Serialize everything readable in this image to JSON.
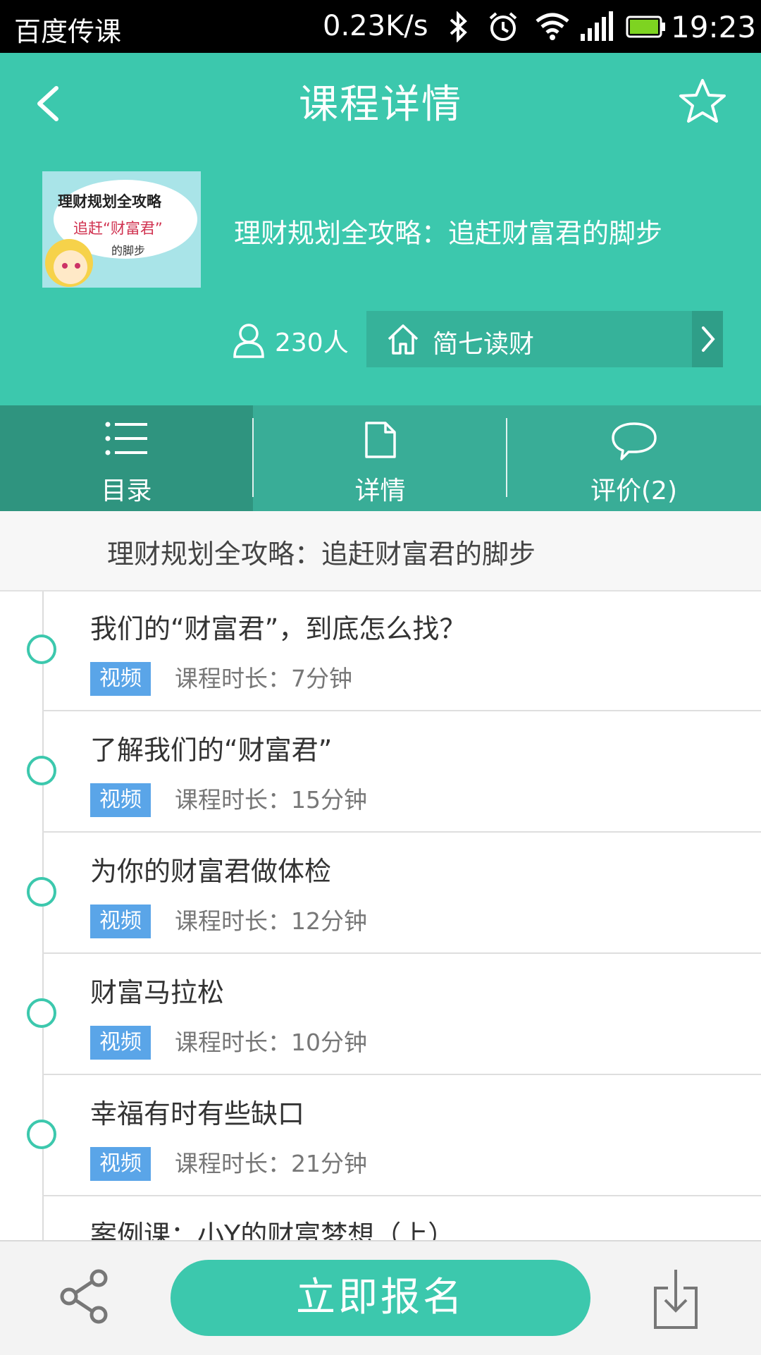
{
  "status_bar": {
    "carrier": "百度传课",
    "net_speed": "0.23K/s",
    "time": "19:23",
    "icons": [
      "bluetooth-icon",
      "alarm-icon",
      "wifi-icon",
      "signal-icon",
      "battery-icon"
    ]
  },
  "header": {
    "title": "课程详情",
    "course_name": "理财规划全攻略：追赶财富君的脚步",
    "learners": "230人",
    "org_name": "简七读财",
    "cover_text": {
      "line1": "理财规划全攻略",
      "line2": "追赶“财富君”",
      "line3": "的脚步"
    }
  },
  "tabs": [
    {
      "label": "目录",
      "icon": "list-icon",
      "active": true
    },
    {
      "label": "详情",
      "icon": "document-icon",
      "active": false
    },
    {
      "label": "评价(2)",
      "icon": "comment-icon",
      "active": false
    }
  ],
  "catalog": {
    "section_title": "理财规划全攻略：追赶财富君的脚步",
    "lessons": [
      {
        "name": "我们的“财富君”，到底怎么找？",
        "tag": "视频",
        "duration": "课程时长：7分钟"
      },
      {
        "name": "了解我们的“财富君”",
        "tag": "视频",
        "duration": "课程时长：15分钟"
      },
      {
        "name": "为你的财富君做体检",
        "tag": "视频",
        "duration": "课程时长：12分钟"
      },
      {
        "name": "财富马拉松",
        "tag": "视频",
        "duration": "课程时长：10分钟"
      },
      {
        "name": "幸福有时有些缺口",
        "tag": "视频",
        "duration": "课程时长：21分钟"
      },
      {
        "name": "案例课：小Y的财富梦想（上）",
        "tag": "",
        "duration": ""
      }
    ]
  },
  "bottom_bar": {
    "enroll_label": "立即报名"
  },
  "colors": {
    "primary": "#3cc8ad",
    "tab_bg": "#39ad97",
    "tab_active": "#2f947f",
    "video_tag": "#5aa5e8"
  }
}
